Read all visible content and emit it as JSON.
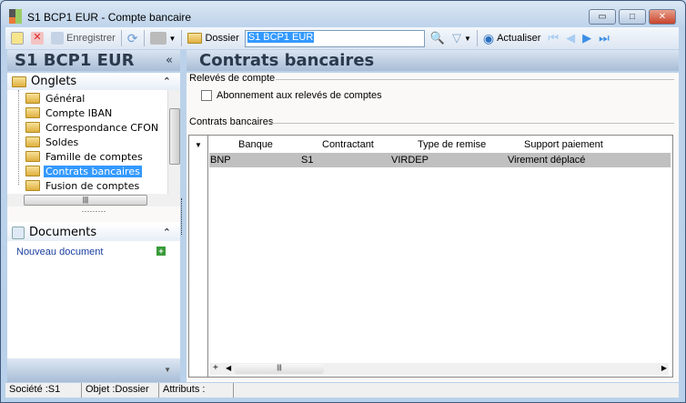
{
  "window": {
    "title": "S1 BCP1 EUR -  Compte bancaire",
    "minimize": "▭",
    "maximize": "□",
    "close": "✕"
  },
  "toolbar": {
    "save_label": "Enregistrer",
    "folder_label": "Dossier",
    "search_value": "S1 BCP1 EUR",
    "refresh_label": "Actualiser"
  },
  "left": {
    "title": "S1 BCP1 EUR",
    "collapse": "«",
    "tabs_header": "Onglets",
    "tabs": [
      {
        "label": "Général"
      },
      {
        "label": "Compte IBAN"
      },
      {
        "label": "Correspondance CFON"
      },
      {
        "label": "Soldes"
      },
      {
        "label": "Famille de comptes"
      },
      {
        "label": "Contrats bancaires",
        "selected": true
      },
      {
        "label": "Fusion de comptes"
      }
    ],
    "documents_header": "Documents",
    "new_document": "Nouveau document"
  },
  "main": {
    "title": "Contrats bancaires",
    "statements_group": "Relevés de compte",
    "subscription_checkbox": {
      "label": "Abonnement aux relevés de comptes",
      "checked": false
    },
    "contracts_group": "Contrats bancaires",
    "columns": [
      "Banque",
      "Contractant",
      "Type de remise",
      "Support paiement"
    ],
    "rows": [
      {
        "banque": "BNP",
        "contractant": "S1",
        "type": "VIRDEP",
        "support": "Virement déplacé"
      }
    ]
  },
  "status": {
    "company": "Société :S1",
    "object": "Objet :Dossier",
    "attributes": "Attributs :"
  }
}
